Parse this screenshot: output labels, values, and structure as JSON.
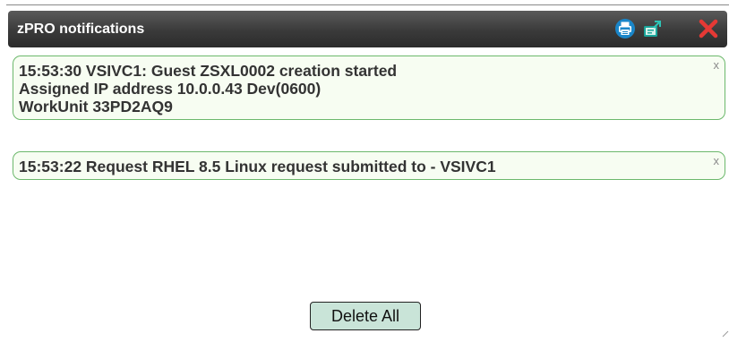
{
  "window": {
    "title": "zPRO notifications",
    "icons": [
      "printer-icon",
      "export-icon",
      "close-icon"
    ]
  },
  "notifications": [
    {
      "lines": [
        "15:53:30 VSIVC1: Guest ZSXL0002 creation started",
        "Assigned IP address 10.0.0.43 Dev(0600)",
        "WorkUnit 33PD2AQ9"
      ],
      "dismiss": "x"
    },
    {
      "lines": [
        "15:53:22 Request RHEL 8.5 Linux request submitted to - VSIVC1"
      ],
      "dismiss": "x"
    }
  ],
  "actions": {
    "delete_all_label": "Delete All"
  },
  "colors": {
    "titlebar": "#3a3a3a",
    "notification_border": "#6cb86c",
    "notification_bg": "#f7fdf2",
    "button_bg": "#c9e4d8",
    "close_red": "#e53935",
    "print_blue": "#1a86c9",
    "export_teal": "#1aa59a"
  }
}
